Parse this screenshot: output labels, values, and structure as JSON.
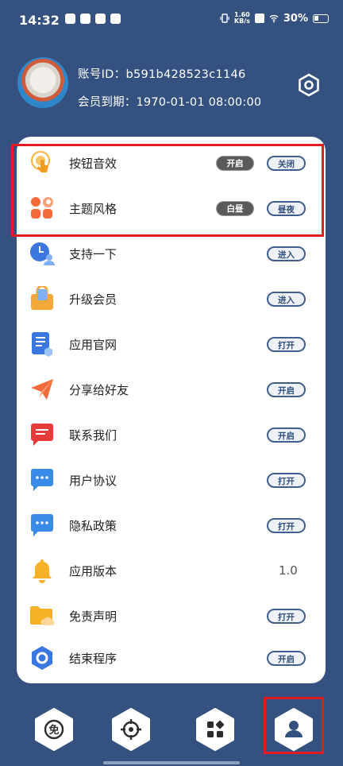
{
  "status_bar": {
    "time": "14:32",
    "net_speed_value": "1.60",
    "net_speed_unit": "KB/s",
    "battery": "30%",
    "icons": [
      "vibrate-icon",
      "x-icon",
      "wifi-icon",
      "battery-icon"
    ]
  },
  "profile": {
    "account_id_label": "账号ID：b591b428523c1146",
    "member_expiry_label": "会员到期：1970-01-01 08:00:00"
  },
  "settings": [
    {
      "icon": "pointer-tap-icon",
      "label": "按钮音效",
      "options": [
        "开启",
        "关闭"
      ]
    },
    {
      "icon": "theme-palette-icon",
      "label": "主题风格",
      "options": [
        "白昼",
        "昼夜"
      ]
    },
    {
      "icon": "support-clock-icon",
      "label": "支持一下",
      "action": "进入"
    },
    {
      "icon": "vip-bag-icon",
      "label": "升级会员",
      "action": "进入"
    },
    {
      "icon": "website-doc-icon",
      "label": "应用官网",
      "action": "打开"
    },
    {
      "icon": "paper-plane-icon",
      "label": "分享给好友",
      "action": "开启"
    },
    {
      "icon": "contact-message-icon",
      "label": "联系我们",
      "action": "开启"
    },
    {
      "icon": "chat-bubble-icon",
      "label": "用户协议",
      "action": "打开"
    },
    {
      "icon": "chat-bubble-icon",
      "label": "隐私政策",
      "action": "打开"
    },
    {
      "icon": "bell-icon",
      "label": "应用版本",
      "value": "1.0"
    },
    {
      "icon": "folder-cloud-icon",
      "label": "免责声明",
      "action": "打开"
    },
    {
      "icon": "power-gear-icon",
      "label": "结束程序",
      "action": "开启"
    }
  ],
  "bottom_nav": {
    "items": [
      {
        "icon": "free-badge-icon",
        "glyph": "免"
      },
      {
        "icon": "target-icon"
      },
      {
        "icon": "grid-apps-icon"
      },
      {
        "icon": "user-profile-icon"
      }
    ]
  },
  "colors": {
    "background": "#34517f",
    "accent_red": "#e11b22",
    "pill_border": "#3f5f8f"
  }
}
